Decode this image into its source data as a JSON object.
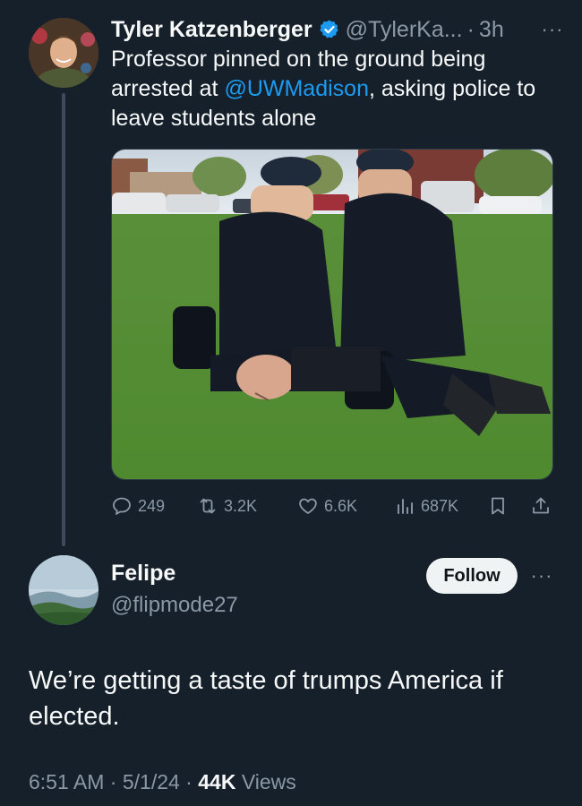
{
  "parent_tweet": {
    "author_name": "Tyler Katzenberger",
    "handle": "@TylerKa...",
    "separator": "·",
    "time": "3h",
    "more": "···",
    "text_before": "Professor pinned on the ground being arrested at ",
    "mention": "@UWMadison",
    "text_after": ", asking police to leave students alone",
    "actions": {
      "replies": "249",
      "reposts": "3.2K",
      "likes": "6.6K",
      "views": "687K"
    },
    "icons": {
      "verified": "verified-badge-icon",
      "reply": "reply-icon",
      "repost": "repost-icon",
      "like": "heart-icon",
      "views": "analytics-icon",
      "bookmark": "bookmark-icon",
      "share": "share-icon"
    }
  },
  "main_tweet": {
    "author_name": "Felipe",
    "handle": "@flipmode27",
    "follow_label": "Follow",
    "more": "···",
    "text": "We’re getting a taste of trumps America if elected.",
    "time": "6:51 AM",
    "sep1": " · ",
    "date": "5/1/24",
    "sep2": " · ",
    "views_count": "44K",
    "views_label": " Views"
  },
  "colors": {
    "background": "#15202b",
    "accent": "#1d9bf0",
    "muted": "#8b98a5",
    "text": "#f7f9f9"
  }
}
